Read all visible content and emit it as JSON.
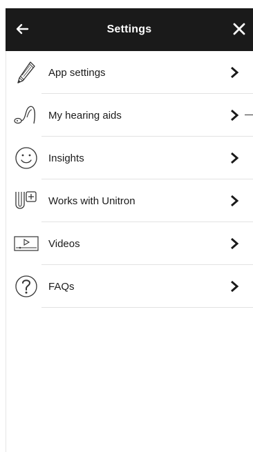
{
  "header": {
    "title": "Settings"
  },
  "menu": {
    "items": [
      {
        "label": "App settings",
        "icon": "pencil-icon"
      },
      {
        "label": "My hearing aids",
        "icon": "hearing-aid-icon"
      },
      {
        "label": "Insights",
        "icon": "smiley-icon"
      },
      {
        "label": "Works with Unitron",
        "icon": "works-with-unitron-icon"
      },
      {
        "label": "Videos",
        "icon": "video-player-icon"
      },
      {
        "label": "FAQs",
        "icon": "question-mark-icon"
      }
    ]
  },
  "colors": {
    "header_bg": "#1a1a1a",
    "header_text": "#ffffff",
    "text": "#1a1a1a",
    "divider": "#e2e2e2"
  }
}
